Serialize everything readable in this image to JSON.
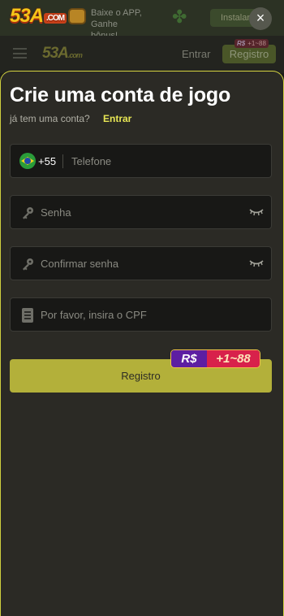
{
  "background": {
    "banner": {
      "logo": "53A",
      "logo_suffix": ".COM",
      "text_line1": "Baixe o APP, Ganhe",
      "text_line2": "bônus!",
      "install_label": "Instalar"
    },
    "header": {
      "logo": "53A",
      "logo_suffix": ".com",
      "login_label": "Entrar",
      "register_label": "Registro",
      "badge_currency": "R$",
      "badge_value": "+1~88"
    }
  },
  "close_label": "×",
  "form": {
    "title": "Crie uma conta de jogo",
    "subtitle": "já tem uma conta?",
    "login_link": "Entrar",
    "phone": {
      "country_code": "+55",
      "placeholder": "Telefone",
      "value": ""
    },
    "password": {
      "placeholder": "Senha",
      "value": ""
    },
    "confirm_password": {
      "placeholder": "Confirmar senha",
      "value": ""
    },
    "cpf": {
      "placeholder": "Por favor, insira o CPF",
      "value": ""
    },
    "submit_label": "Registro",
    "promo": {
      "currency": "R$",
      "value": "+1~88"
    }
  },
  "colors": {
    "accent": "#e7e654",
    "button": "#b3b03a",
    "sheet_bg": "#2b2a25",
    "field_bg": "#181816",
    "promo_currency_bg": "#5d1ea2",
    "promo_value_bg": "#d8214b"
  },
  "icons": [
    "close-icon",
    "menu-icon",
    "brazil-flag-icon",
    "key-icon",
    "eye-closed-icon",
    "id-card-icon"
  ]
}
